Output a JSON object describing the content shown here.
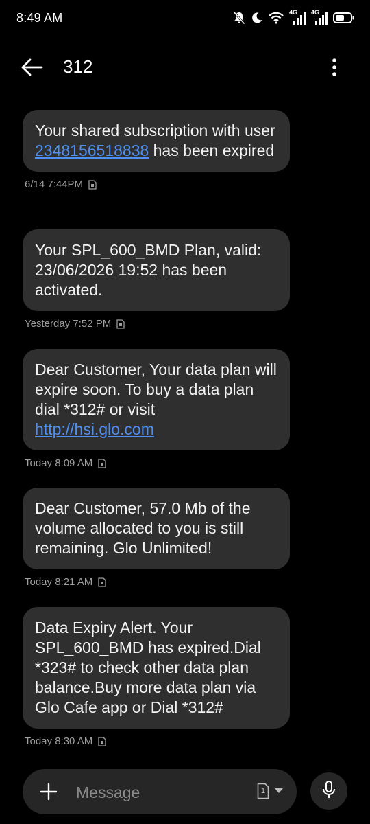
{
  "status_bar": {
    "time": "8:49 AM",
    "network_1": "4G",
    "network_2": "4G"
  },
  "header": {
    "title": "312"
  },
  "messages": [
    {
      "text_before": "Your shared subscription with user ",
      "link": "2348156518838",
      "text_after": " has been expired",
      "timestamp": "6/14 7:44PM"
    },
    {
      "text_before": "Your SPL_600_BMD Plan, valid: 23/06/2026 19:52 has been activated.",
      "link": "",
      "text_after": "",
      "timestamp": "Yesterday 7:52 PM"
    },
    {
      "text_before": "Dear Customer, Your data plan will expire soon. To buy a data plan dial *312# or visit ",
      "link": "http://hsi.glo.com",
      "text_after": "",
      "timestamp": "Today 8:09 AM"
    },
    {
      "text_before": "Dear Customer, 57.0 Mb of the volume allocated to you is still remaining. Glo Unlimited!",
      "link": "",
      "text_after": "",
      "timestamp": "Today 8:21 AM"
    },
    {
      "text_before": "Data Expiry Alert. Your SPL_600_BMD has expired.Dial *323# to check other data plan balance.Buy more data plan via Glo Cafe app or Dial *312#",
      "link": "",
      "text_after": "",
      "timestamp": "Today 8:30 AM"
    }
  ],
  "composer": {
    "placeholder": "Message",
    "sim_number": "1"
  },
  "colors": {
    "background": "#000000",
    "bubble": "#2f2f2f",
    "link": "#4d8ff2",
    "meta_text": "#9e9e9e",
    "composer": "#262626"
  }
}
